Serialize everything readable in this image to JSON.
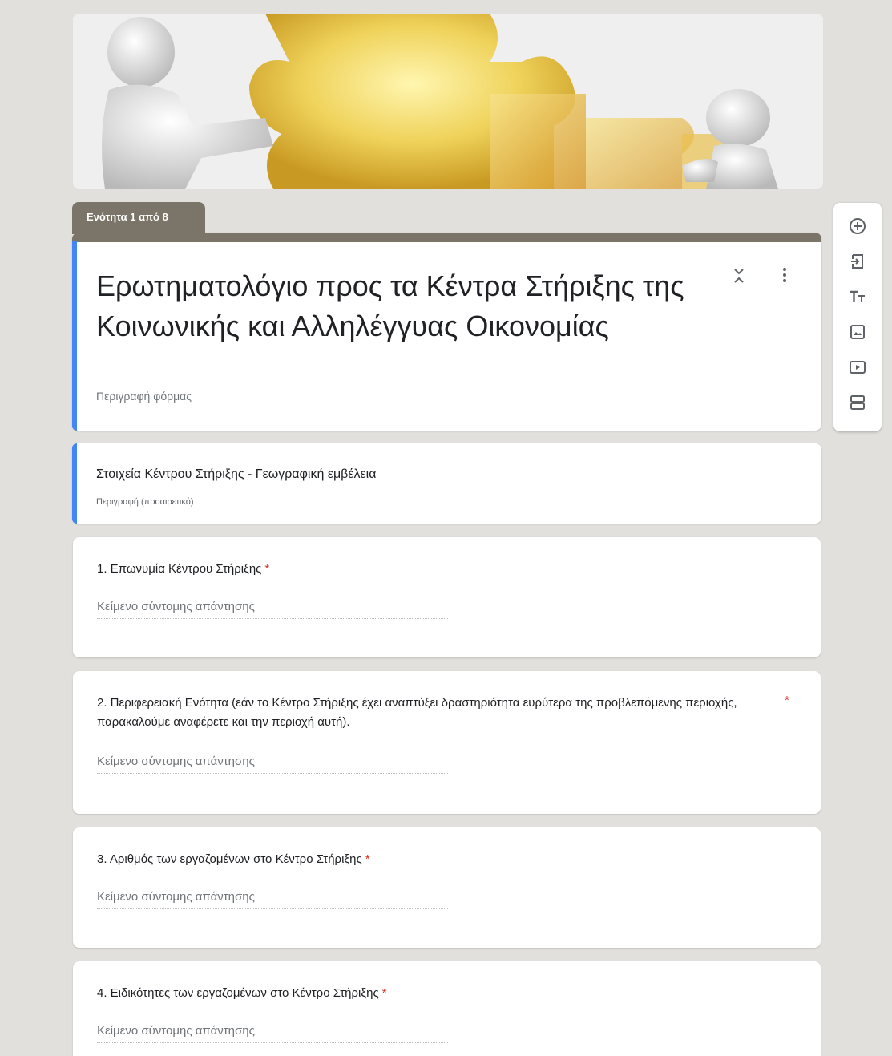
{
  "section_tab": {
    "label": "Ενότητα 1 από 8"
  },
  "form": {
    "title": "Ερωτηματολόγιο προς τα Κέντρα Στήριξης της Κοινωνικής και Αλληλέγγυας Οικονομίας",
    "description_placeholder": "Περιγραφή φόρμας"
  },
  "section": {
    "title": "Στοιχεία Κέντρου Στήριξης - Γεωγραφική εμβέλεια",
    "description_placeholder": "Περιγραφή (προαιρετικό)"
  },
  "questions": [
    {
      "title": "1. Επωνυμία Κέντρου Στήριξης",
      "required_mark": "*",
      "answer_placeholder": "Κείμενο σύντομης απάντησης"
    },
    {
      "title": "2. Περιφερειακή Ενότητα (εάν το Κέντρο Στήριξης έχει αναπτύξει δραστηριότητα ευρύτερα της προβλεπόμενης περιοχής, παρακαλούμε αναφέρετε και την περιοχή αυτή).",
      "required_mark": "*",
      "answer_placeholder": "Κείμενο σύντομης απάντησης"
    },
    {
      "title": "3. Αριθμός των εργαζομένων στο Κέντρο Στήριξης",
      "required_mark": "*",
      "answer_placeholder": "Κείμενο σύντομης απάντησης"
    },
    {
      "title": "4. Ειδικότητες των εργαζομένων στο Κέντρο Στήριξης",
      "required_mark": "*",
      "answer_placeholder": "Κείμενο σύντομης απάντησης"
    }
  ],
  "toolbar": {
    "items": [
      "add-question-icon",
      "import-questions-icon",
      "add-title-icon",
      "add-image-icon",
      "add-video-icon",
      "add-section-icon"
    ]
  },
  "colors": {
    "accent": "#4285f4",
    "section_header": "#7a7568",
    "required": "#d93025",
    "background": "#e1e0dd"
  }
}
